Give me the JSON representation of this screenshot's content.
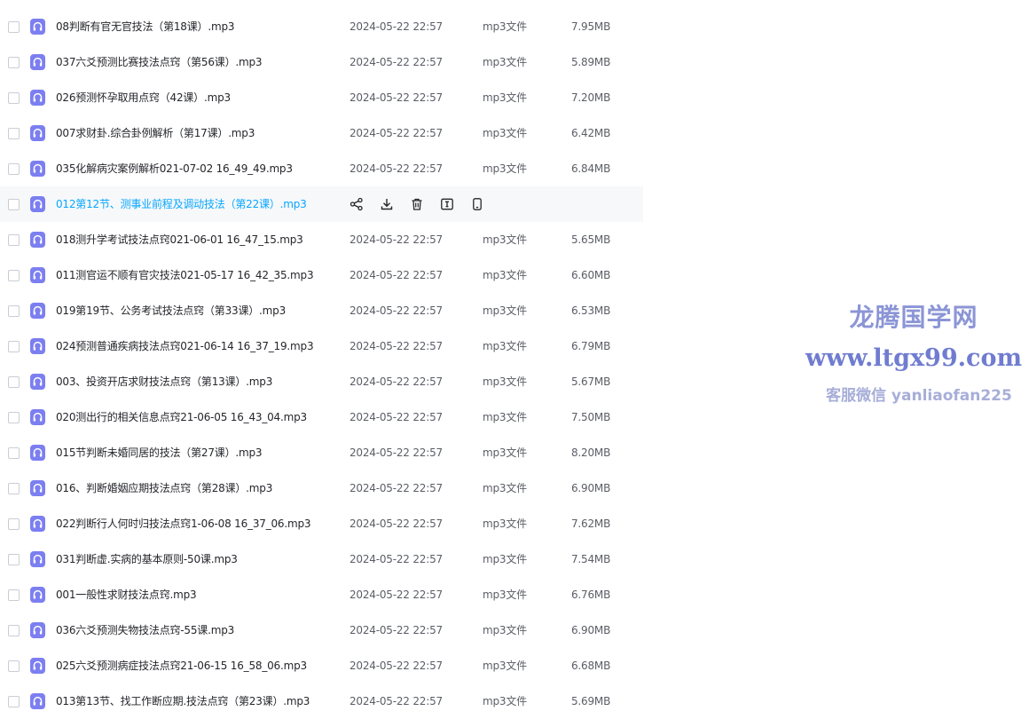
{
  "colors": {
    "icon_purple": "#7c7ff0",
    "hover_text": "#06a7ff",
    "watermark": "#8b95d6"
  },
  "hover_actions": [
    "share-icon",
    "download-icon",
    "delete-icon",
    "rename-icon",
    "more-icon"
  ],
  "files": [
    {
      "name": "08判断有官无官技法（第18课）.mp3",
      "date": "2024-05-22 22:57",
      "type": "mp3文件",
      "size": "7.95MB"
    },
    {
      "name": "037六爻预测比赛技法点窍（第56课）.mp3",
      "date": "2024-05-22 22:57",
      "type": "mp3文件",
      "size": "5.89MB"
    },
    {
      "name": "026预测怀孕取用点窍（42课）.mp3",
      "date": "2024-05-22 22:57",
      "type": "mp3文件",
      "size": "7.20MB"
    },
    {
      "name": "007求财卦.综合卦例解析（第17课）.mp3",
      "date": "2024-05-22 22:57",
      "type": "mp3文件",
      "size": "6.42MB"
    },
    {
      "name": "035化解病灾案例解析021-07-02 16_49_49.mp3",
      "date": "2024-05-22 22:57",
      "type": "mp3文件",
      "size": "6.84MB"
    },
    {
      "name": "012第12节、测事业前程及调动技法（第22课）.mp3",
      "date": "",
      "type": "",
      "size": "",
      "hover": true
    },
    {
      "name": "018测升学考试技法点窍021-06-01 16_47_15.mp3",
      "date": "2024-05-22 22:57",
      "type": "mp3文件",
      "size": "5.65MB"
    },
    {
      "name": "011测官运不顺有官灾技法021-05-17 16_42_35.mp3",
      "date": "2024-05-22 22:57",
      "type": "mp3文件",
      "size": "6.60MB"
    },
    {
      "name": "019第19节、公务考试技法点窍（第33课）.mp3",
      "date": "2024-05-22 22:57",
      "type": "mp3文件",
      "size": "6.53MB"
    },
    {
      "name": "024预测普通疾病技法点窍021-06-14 16_37_19.mp3",
      "date": "2024-05-22 22:57",
      "type": "mp3文件",
      "size": "6.79MB"
    },
    {
      "name": "003、投资开店求财技法点窍（第13课）.mp3",
      "date": "2024-05-22 22:57",
      "type": "mp3文件",
      "size": "5.67MB"
    },
    {
      "name": "020测出行的相关信息点窍21-06-05 16_43_04.mp3",
      "date": "2024-05-22 22:57",
      "type": "mp3文件",
      "size": "7.50MB"
    },
    {
      "name": "015节判断未婚同居的技法（第27课）.mp3",
      "date": "2024-05-22 22:57",
      "type": "mp3文件",
      "size": "8.20MB"
    },
    {
      "name": "016、判断婚姻应期技法点窍（第28课）.mp3",
      "date": "2024-05-22 22:57",
      "type": "mp3文件",
      "size": "6.90MB"
    },
    {
      "name": "022判断行人何时归技法点窍1-06-08 16_37_06.mp3",
      "date": "2024-05-22 22:57",
      "type": "mp3文件",
      "size": "7.62MB"
    },
    {
      "name": "031判断虚.实病的基本原则-50课.mp3",
      "date": "2024-05-22 22:57",
      "type": "mp3文件",
      "size": "7.54MB"
    },
    {
      "name": "001一般性求财技法点窍.mp3",
      "date": "2024-05-22 22:57",
      "type": "mp3文件",
      "size": "6.76MB"
    },
    {
      "name": "036六爻预测失物技法点窍-55课.mp3",
      "date": "2024-05-22 22:57",
      "type": "mp3文件",
      "size": "6.90MB"
    },
    {
      "name": "025六爻预测病症技法点窍21-06-15 16_58_06.mp3",
      "date": "2024-05-22 22:57",
      "type": "mp3文件",
      "size": "6.68MB"
    },
    {
      "name": "013第13节、找工作断应期.技法点窍（第23课）.mp3",
      "date": "2024-05-22 22:57",
      "type": "mp3文件",
      "size": "5.69MB"
    }
  ],
  "watermark": {
    "title": "龙腾国学网",
    "url": "www.ltgx99.com",
    "contact": "客服微信 yanliaofan225"
  }
}
